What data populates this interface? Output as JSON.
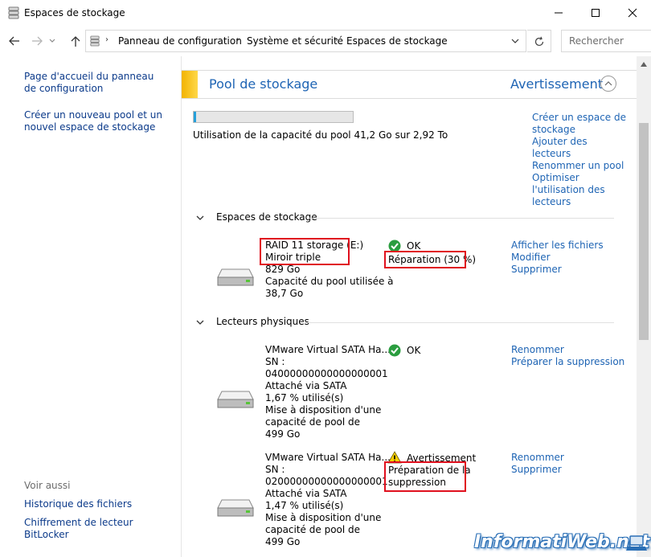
{
  "window": {
    "title": "Espaces de stockage",
    "icon": "storage-spaces-icon"
  },
  "navbar": {
    "breadcrumb": [
      "Panneau de configuration",
      "Système et sécurité",
      "Espaces de stockage"
    ],
    "search_placeholder": "Rechercher"
  },
  "sidebar": {
    "links": [
      "Page d'accueil du panneau de configuration",
      "Créer un nouveau pool et un nouvel espace de stockage"
    ],
    "see_also_heading": "Voir aussi",
    "see_also": [
      "Historique des fichiers",
      "Chiffrement de lecteur BitLocker"
    ]
  },
  "pool": {
    "title": "Pool de stockage",
    "status": "Avertissement",
    "usage_fraction": 0.014,
    "usage_text": "Utilisation de la capacité du pool 41,2 Go sur 2,92 To",
    "actions": [
      "Créer un espace de stockage",
      "Ajouter des lecteurs",
      "Renommer un pool",
      "Optimiser l'utilisation des lecteurs"
    ]
  },
  "spaces": {
    "heading": "Espaces de stockage",
    "items": [
      {
        "name": "RAID 11 storage (E:)",
        "resiliency": "Miroir triple",
        "size": "829 Go",
        "pool_used_label": "Capacité du pool utilisée à",
        "pool_used_value": "38,7 Go",
        "status": "OK",
        "status_detail": "Réparation (30 %)",
        "actions": [
          "Afficher les fichiers",
          "Modifier",
          "Supprimer"
        ]
      }
    ]
  },
  "physical": {
    "heading": "Lecteurs physiques",
    "items": [
      {
        "name": "VMware Virtual SATA Ha...",
        "sn_label": "SN :",
        "sn": "04000000000000000001",
        "attach": "Attaché via SATA",
        "used": "1,67 % utilisé(s)",
        "cap_label1": "Mise à disposition d'une",
        "cap_label2": "capacité de pool de",
        "cap_value": "499 Go",
        "status": "OK",
        "actions": [
          "Renommer",
          "Préparer la suppression"
        ]
      },
      {
        "name": "VMware Virtual SATA Ha...",
        "sn_label": "SN :",
        "sn": "02000000000000000001",
        "attach": "Attaché via SATA",
        "used": "1,47 % utilisé(s)",
        "cap_label1": "Mise à disposition d'une",
        "cap_label2": "capacité de pool de",
        "cap_value": "499 Go",
        "status": "Avertissement",
        "status_detail_1": "Préparation de la",
        "status_detail_2": "suppression",
        "actions": [
          "Renommer",
          "Supprimer"
        ]
      }
    ]
  },
  "watermark": "InformatiWeb.net",
  "colors": {
    "link": "#1e64b4",
    "warning_stripe": "#f2b300",
    "highlight": "#e0101e",
    "ok": "#2a9d3f"
  }
}
